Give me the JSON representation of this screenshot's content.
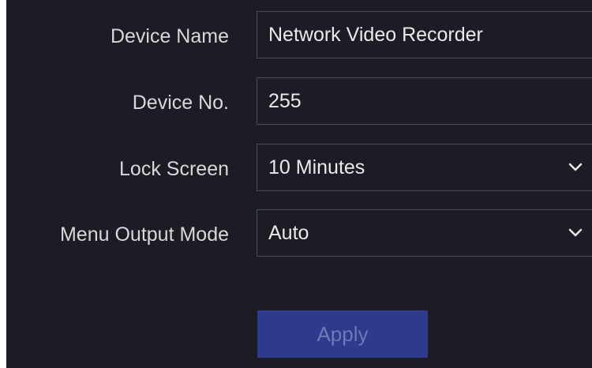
{
  "form": {
    "device_name": {
      "label": "Device Name",
      "value": "Network Video Recorder"
    },
    "device_no": {
      "label": "Device No.",
      "value": "255"
    },
    "lock_screen": {
      "label": "Lock Screen",
      "value": "10 Minutes",
      "icon": "chevron-down-icon"
    },
    "menu_output_mode": {
      "label": "Menu Output Mode",
      "value": "Auto",
      "icon": "chevron-down-icon"
    }
  },
  "actions": {
    "apply_label": "Apply"
  },
  "colors": {
    "background": "#1b1c24",
    "field_border": "#4a4c57",
    "label_text": "#d7d8dc",
    "apply_button": "#2e3a8c",
    "apply_text": "#6f79b8"
  }
}
